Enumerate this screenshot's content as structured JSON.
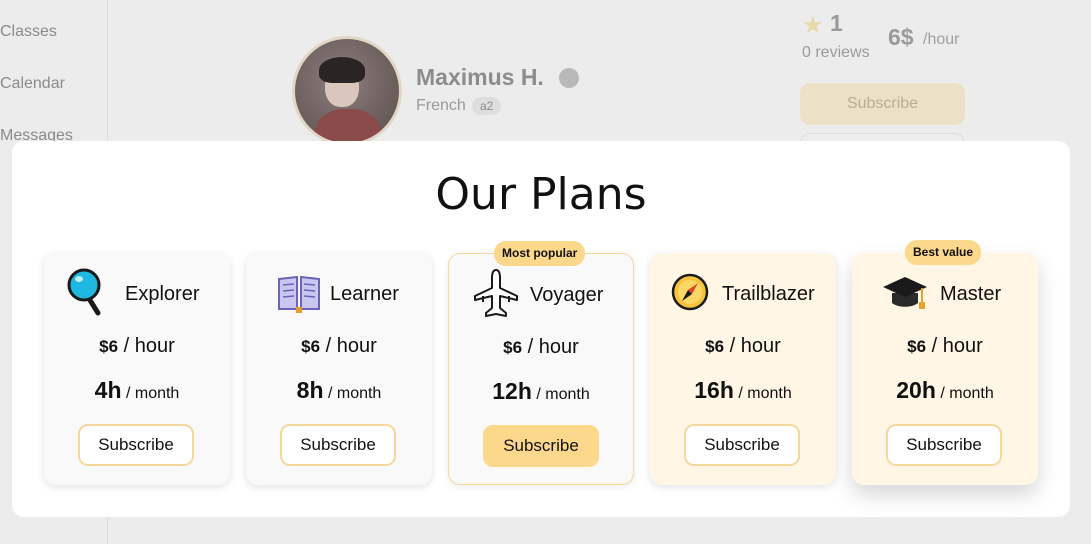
{
  "sidebar": {
    "items": [
      {
        "label": "Classes"
      },
      {
        "label": "Calendar"
      },
      {
        "label": "Messages"
      }
    ]
  },
  "profile": {
    "name": "Maximus H.",
    "language": "French",
    "level": "a2",
    "rating": "1",
    "reviews": "0 reviews",
    "price": "6$",
    "price_unit": "/hour",
    "subscribe_label": "Subscribe"
  },
  "modal": {
    "title": "Our Plans",
    "plans": [
      {
        "name": "Explorer",
        "icon": "magnifying-glass-icon",
        "price": "$6",
        "per_hour": "/ hour",
        "hours": "4h",
        "per_month": "/ month",
        "button": "Subscribe",
        "badge": ""
      },
      {
        "name": "Learner",
        "icon": "open-book-icon",
        "price": "$6",
        "per_hour": "/ hour",
        "hours": "8h",
        "per_month": "/ month",
        "button": "Subscribe",
        "badge": ""
      },
      {
        "name": "Voyager",
        "icon": "airplane-icon",
        "price": "$6",
        "per_hour": "/ hour",
        "hours": "12h",
        "per_month": "/ month",
        "button": "Subscribe",
        "badge": "Most popular"
      },
      {
        "name": "Trailblazer",
        "icon": "compass-icon",
        "price": "$6",
        "per_hour": "/ hour",
        "hours": "16h",
        "per_month": "/ month",
        "button": "Subscribe",
        "badge": ""
      },
      {
        "name": "Master",
        "icon": "graduation-cap-icon",
        "price": "$6",
        "per_hour": "/ hour",
        "hours": "20h",
        "per_month": "/ month",
        "button": "Subscribe",
        "badge": "Best value"
      }
    ]
  },
  "colors": {
    "accent": "#fcd88c",
    "accent_border": "#f5d89e",
    "warm_card": "#fff6e6",
    "card": "#f9f9f9"
  }
}
